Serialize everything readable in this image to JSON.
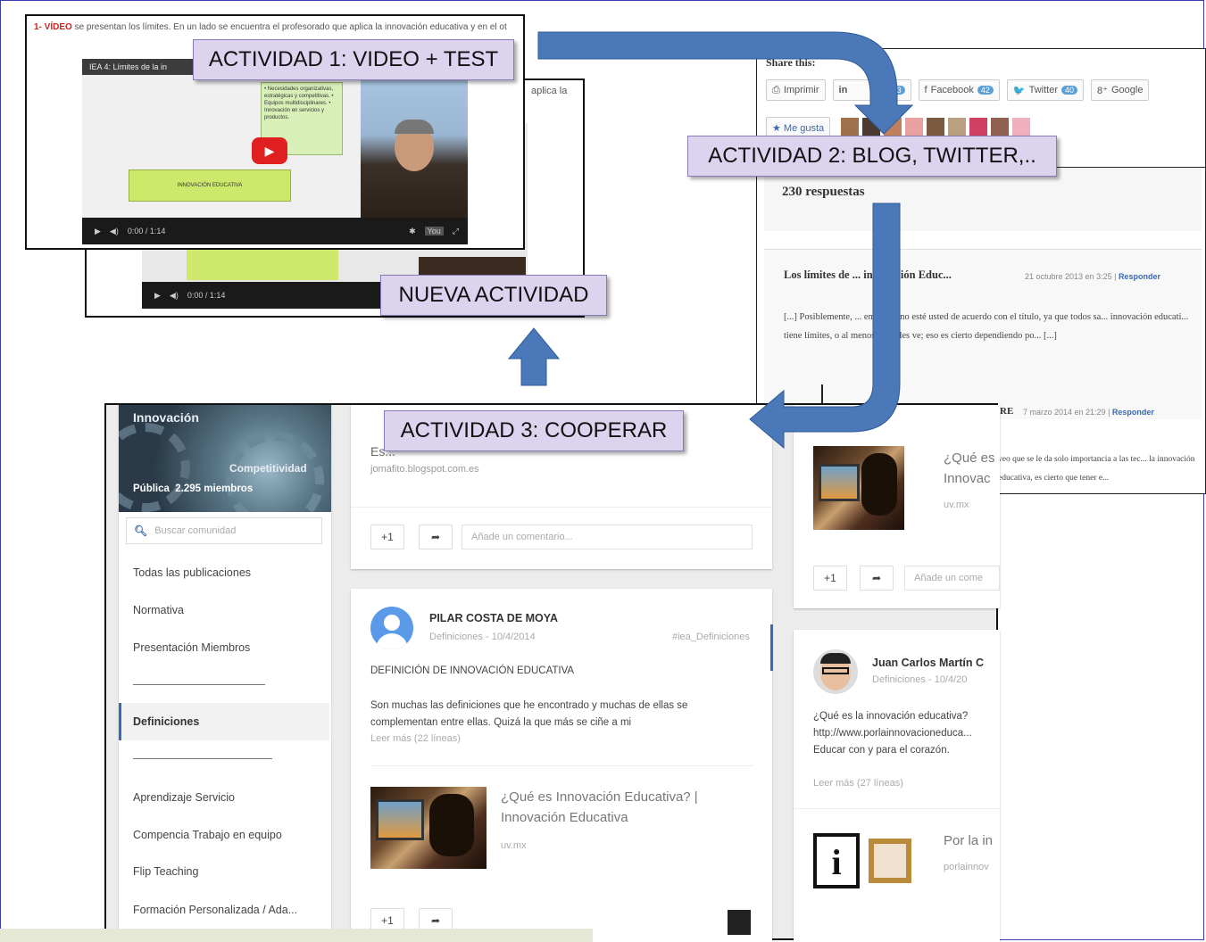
{
  "video_panel": {
    "intro_num": "1- VÍDEO",
    "intro_text": "se presentan los límites. En un lado se encuentra el profesorado que aplica la innovación educativa y en el ot",
    "back_text": "aplica la",
    "video_title": "IEA 4: Límites de la in",
    "slide_bullets": "• Necesidades organizativas, estratégicas y competitivas. • Equipos multidisciplinares. • Innovación en servicios y productos.",
    "slide_box_label": "INNOVACIÓN EDUCATIVA",
    "time_front": "0:00 / 1:14",
    "time_back": "0:00 / 1:14"
  },
  "callouts": {
    "act1": "ACTIVIDAD 1: VIDEO + TEST",
    "act2": "ACTIVIDAD 2: BLOG, TWITTER,..",
    "nueva": "NUEVA  ACTIVIDAD",
    "act3": "ACTIVIDAD 3: COOPERAR"
  },
  "blog": {
    "share_title": "Share this:",
    "share_buttons": [
      {
        "label": "Imprimir",
        "count": ""
      },
      {
        "label": "in",
        "count": "13"
      },
      {
        "label": "Facebook",
        "count": "42"
      },
      {
        "label": "Twitter",
        "count": "40"
      },
      {
        "label": "Google",
        "count": ""
      }
    ],
    "like_label": "★ Me gusta",
    "responses": "230 respuestas",
    "comment1_title": "Los límites de ... innovación Educ...",
    "comment1_meta": "21 octubre 2013 en 3:25",
    "reply_label": "Responder",
    "comment1_text": "[...] Posiblemente, ... empezar, no esté usted de acuerdo con el título, ya que todos sa... innovación educati... tiene límites, o al menos no se les ve; eso es cierto dependiendo po... [...]",
    "comment2_name": "RE",
    "comment2_meta": "7 marzo 2014 en 21:29",
    "comment2_text": "veo que se le da solo importancia a las tec... la innovación educativa, es cierto que tener e..."
  },
  "community": {
    "banner_title": "Innovación",
    "banner_sub": "Competitividad",
    "visibility": "Pública",
    "members": "2.295 miembros",
    "search_placeholder": "Buscar comunidad",
    "nav": [
      "Todas las publicaciones",
      "Normativa",
      "Presentación Miembros",
      "Definiciones",
      "Aprendizaje Servicio",
      "Compencia Trabajo en equipo",
      "Flip Teaching",
      "Formación Personalizada / Ada..."
    ],
    "post0_head": "Es...",
    "post0_link": "jomafito.blogspot.com.es",
    "plus_one": "+1",
    "comment_placeholder": "Añade un comentario...",
    "post1": {
      "author": "PILAR COSTA DE MOYA",
      "category": "Definiciones",
      "date": "10/4/2014",
      "hashtag": "#iea_Definiciones",
      "title": "DEFINICIÓN DE INNOVACIÓN EDUCATIVA",
      "body": "Son muchas las definiciones que he encontrado y muchas de ellas se complementan entre ellas. Quizá la que más se ciñe a mi",
      "read_more": "Leer más (22 líneas)",
      "link_title": "¿Qué es Innovación Educativa? | Innovación Educativa",
      "link_domain": "uv.mx"
    },
    "right_card": {
      "link_title": "¿Qué es Innovac",
      "link_domain": "uv.mx",
      "comment_placeholder": "Añade un come"
    },
    "post2": {
      "author": "Juan Carlos Martín C",
      "category": "Definiciones",
      "date": "10/4/20",
      "body": "¿Qué es la innovación educativa? http://www.porlainnovacioneduca... Educar con y para el corazón.",
      "read_more": "Leer más (27 líneas)",
      "link_title": "Por la in",
      "link_domain": "porlainnov"
    }
  },
  "colors": {
    "callout_bg": "#dcd3ef",
    "arrow": "#4a78b8",
    "intro_red": "#cc2222",
    "youtube_red": "#e02020"
  }
}
